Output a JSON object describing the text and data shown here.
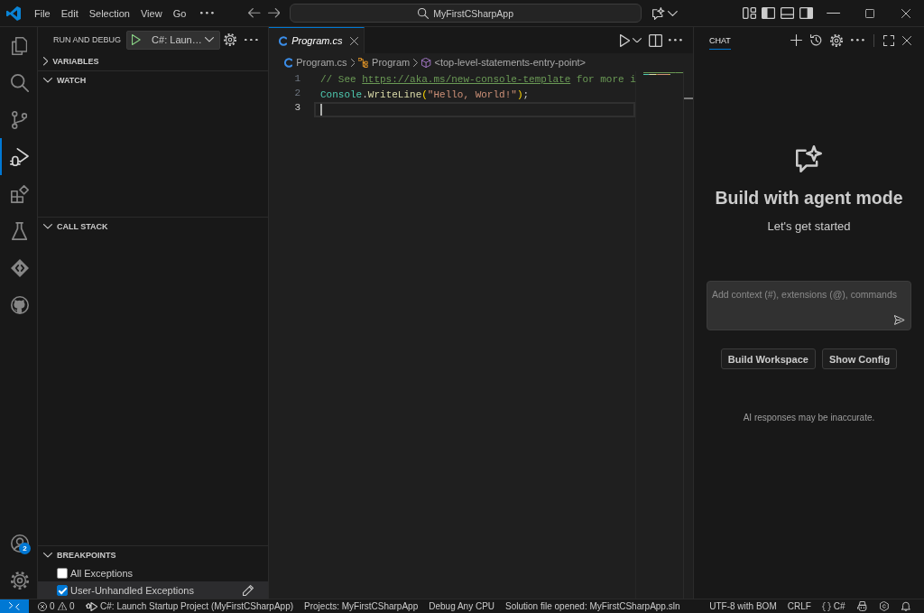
{
  "title_bar": {
    "menu": [
      "File",
      "Edit",
      "Selection",
      "View",
      "Go"
    ],
    "command_center": "MyFirstCSharpApp"
  },
  "activity_bar": {
    "items": [
      {
        "kind": "explorer",
        "selected": false
      },
      {
        "kind": "search",
        "selected": false
      },
      {
        "kind": "source-control",
        "selected": false
      },
      {
        "kind": "run-debug",
        "selected": true
      },
      {
        "kind": "extensions",
        "selected": false
      },
      {
        "kind": "testing",
        "selected": false
      },
      {
        "kind": "diamond",
        "selected": false
      },
      {
        "kind": "cat-logo",
        "selected": false
      }
    ],
    "bottom_items": [
      {
        "kind": "accounts",
        "badge": "2"
      },
      {
        "kind": "settings"
      }
    ]
  },
  "sidebar": {
    "title": "RUN AND DEBUG",
    "launch_config": "C#: Laun…",
    "sections": [
      {
        "title": "VARIABLES",
        "expanded": false
      },
      {
        "title": "WATCH",
        "expanded": true
      },
      {
        "title": "CALL STACK",
        "expanded": true
      },
      {
        "title": "BREAKPOINTS",
        "expanded": true,
        "items": [
          {
            "label": "All Exceptions",
            "checked": false,
            "selected": false
          },
          {
            "label": "User-Unhandled Exceptions",
            "checked": true,
            "selected": true
          }
        ]
      }
    ]
  },
  "editor": {
    "tabs": [
      {
        "label": "Program.cs",
        "selected": true,
        "preview": true
      }
    ],
    "breadcrumbs": [
      {
        "kind": "file",
        "label": "Program.cs"
      },
      {
        "kind": "class",
        "label": "Program"
      },
      {
        "kind": "method",
        "label": "<top-level-statements-entry-point>"
      }
    ],
    "lines": [
      {
        "number": "1",
        "current": false,
        "tokens": [
          {
            "kind": "comment",
            "text": "// See "
          },
          {
            "kind": "link",
            "text": "https://aka.ms/new-console-template"
          },
          {
            "kind": "comment",
            "text": " for more i"
          }
        ]
      },
      {
        "number": "2",
        "current": false,
        "tokens": [
          {
            "kind": "type",
            "text": "Console"
          },
          {
            "kind": "plain",
            "text": "."
          },
          {
            "kind": "method",
            "text": "WriteLine"
          },
          {
            "kind": "bracket",
            "text": "("
          },
          {
            "kind": "string",
            "text": "\"Hello, World!\""
          },
          {
            "kind": "bracket",
            "text": ")"
          },
          {
            "kind": "plain",
            "text": ";"
          }
        ]
      },
      {
        "number": "3",
        "current": true
      }
    ]
  },
  "chat": {
    "tabs": [
      {
        "label": "CHAT",
        "selected": true
      }
    ],
    "heading": "Build with agent mode",
    "subheading": "Let's get started",
    "input": {
      "placeholder": "Add context (#), extensions (@), commands"
    },
    "buttons": [
      "Build Workspace",
      "Show Config"
    ],
    "disclaimer": "AI responses may be inaccurate."
  },
  "status_bar": {
    "problems": {
      "errors": "0",
      "warnings": "0"
    },
    "left_items": [
      {
        "kind": "launch",
        "label": "C#: Launch Startup Project (MyFirstCSharpApp)"
      },
      {
        "kind": "text",
        "label": "Projects: MyFirstCSharpApp"
      },
      {
        "kind": "text",
        "label": "Debug Any CPU"
      },
      {
        "kind": "text",
        "label": "Solution file opened: MyFirstCSharpApp.sln"
      }
    ],
    "right_items": [
      {
        "kind": "text",
        "label": "UTF-8 with BOM"
      },
      {
        "kind": "text",
        "label": "CRLF"
      },
      {
        "kind": "language",
        "label": "C#"
      },
      {
        "kind": "copilot"
      },
      {
        "kind": "extension"
      },
      {
        "kind": "notifications"
      }
    ]
  }
}
